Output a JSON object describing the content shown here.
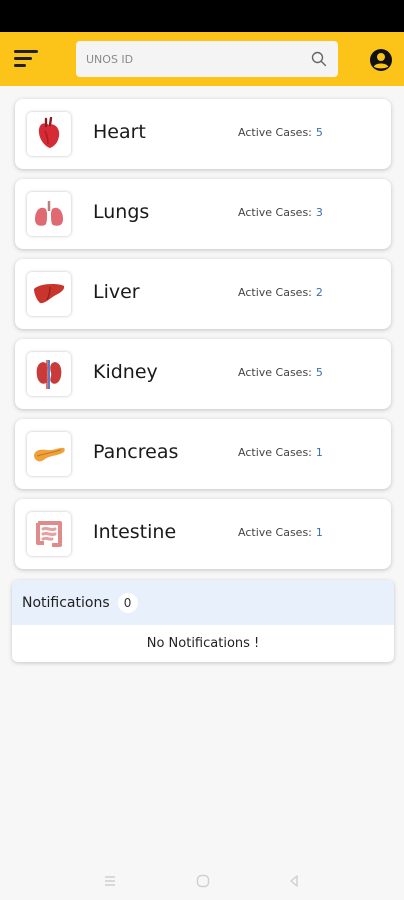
{
  "header": {
    "search_placeholder": "UNOS ID",
    "brand_color": "#fcc419"
  },
  "organs": [
    {
      "name": "Heart",
      "cases_label": "Active Cases:",
      "count": "5",
      "icon": "heart-icon"
    },
    {
      "name": "Lungs",
      "cases_label": "Active Cases:",
      "count": "3",
      "icon": "lungs-icon"
    },
    {
      "name": "Liver",
      "cases_label": "Active Cases:",
      "count": "2",
      "icon": "liver-icon"
    },
    {
      "name": "Kidney",
      "cases_label": "Active Cases:",
      "count": "5",
      "icon": "kidney-icon"
    },
    {
      "name": "Pancreas",
      "cases_label": "Active Cases:",
      "count": "1",
      "icon": "pancreas-icon"
    },
    {
      "name": "Intestine",
      "cases_label": "Active Cases:",
      "count": "1",
      "icon": "intestine-icon"
    }
  ],
  "notifications": {
    "title": "Notifications",
    "count": "0",
    "empty_message": "No Notifications !"
  }
}
